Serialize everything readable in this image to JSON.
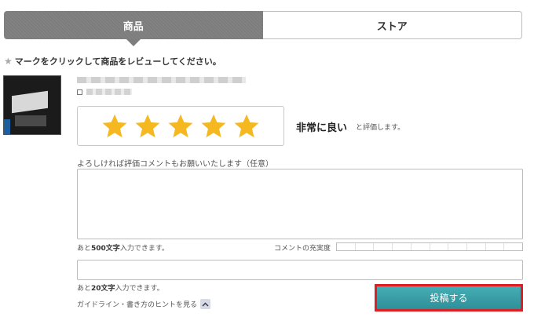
{
  "tabs": [
    {
      "label": "商品",
      "active": true
    },
    {
      "label": "ストア",
      "active": false
    }
  ],
  "instruction": "マークをクリックして商品をレビューしてください。",
  "product": {
    "thumbnail_icon": "product-thumbnail"
  },
  "rating": {
    "value": 5,
    "max": 5,
    "label": "非常に良い",
    "suffix": "と評価します。",
    "star_color": "#f5b820"
  },
  "comment": {
    "label": "よろしければ評価コメントもお願いいたします（任意）",
    "value": "",
    "remaining_prefix": "あと",
    "remaining_count": "500文字",
    "remaining_suffix": "入力できます。",
    "fill_label": "コメントの充実度",
    "fill_level": 0
  },
  "title_input": {
    "value": "",
    "remaining_prefix": "あと",
    "remaining_count": "20文字",
    "remaining_suffix": "入力できます。"
  },
  "guide_link": "ガイドライン・書き方のヒントを見る",
  "submit_label": "投稿する",
  "colors": {
    "tab_active": "#7d7d7d",
    "submit": "#3a9fa8",
    "highlight_border": "#dd1f24"
  }
}
